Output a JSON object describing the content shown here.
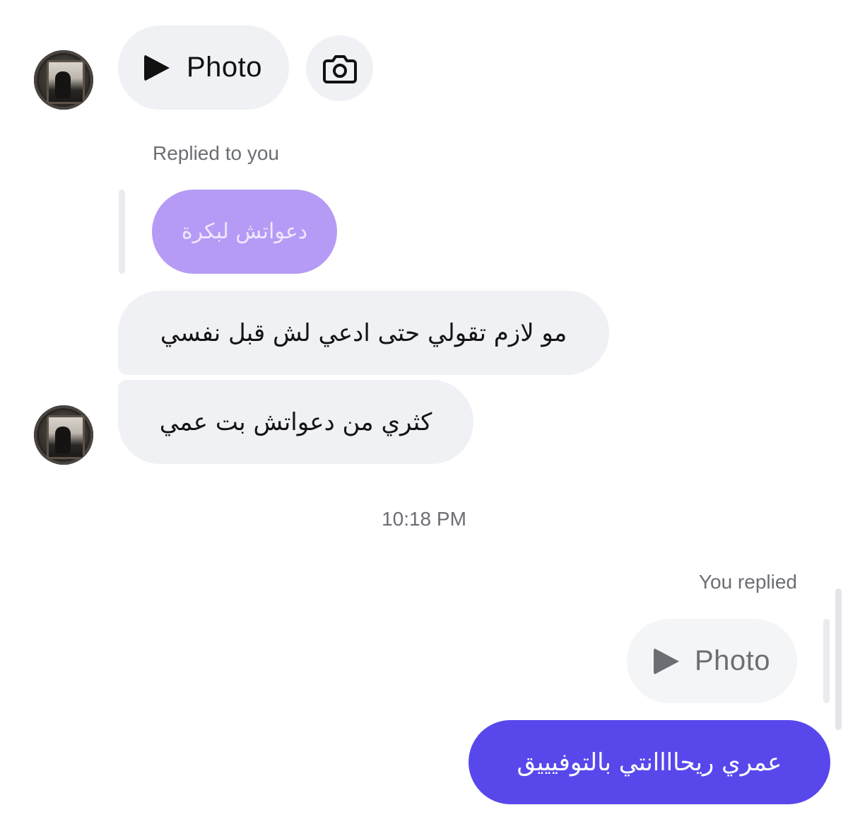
{
  "messages": {
    "first_photo_label": "Photo",
    "replied_label": "Replied to you",
    "quoted_text": "دعواتش لبكرة",
    "reply_line_1": "مو لازم تقولي حتى ادعي لش قبل نفسي",
    "reply_line_2": "كثري من دعواتش بت عمي",
    "timestamp": "10:18 PM",
    "you_replied_label": "You replied",
    "my_photo_label": "Photo",
    "my_message": "عمري ريحاااانتي بالتوفيييق"
  },
  "colors": {
    "incoming_bubble": "#eff1f4",
    "quoted_bubble": "#b59bf5",
    "outgoing_bubble": "#5848ec"
  },
  "icons": {
    "play": "play-icon",
    "camera": "camera-icon"
  }
}
